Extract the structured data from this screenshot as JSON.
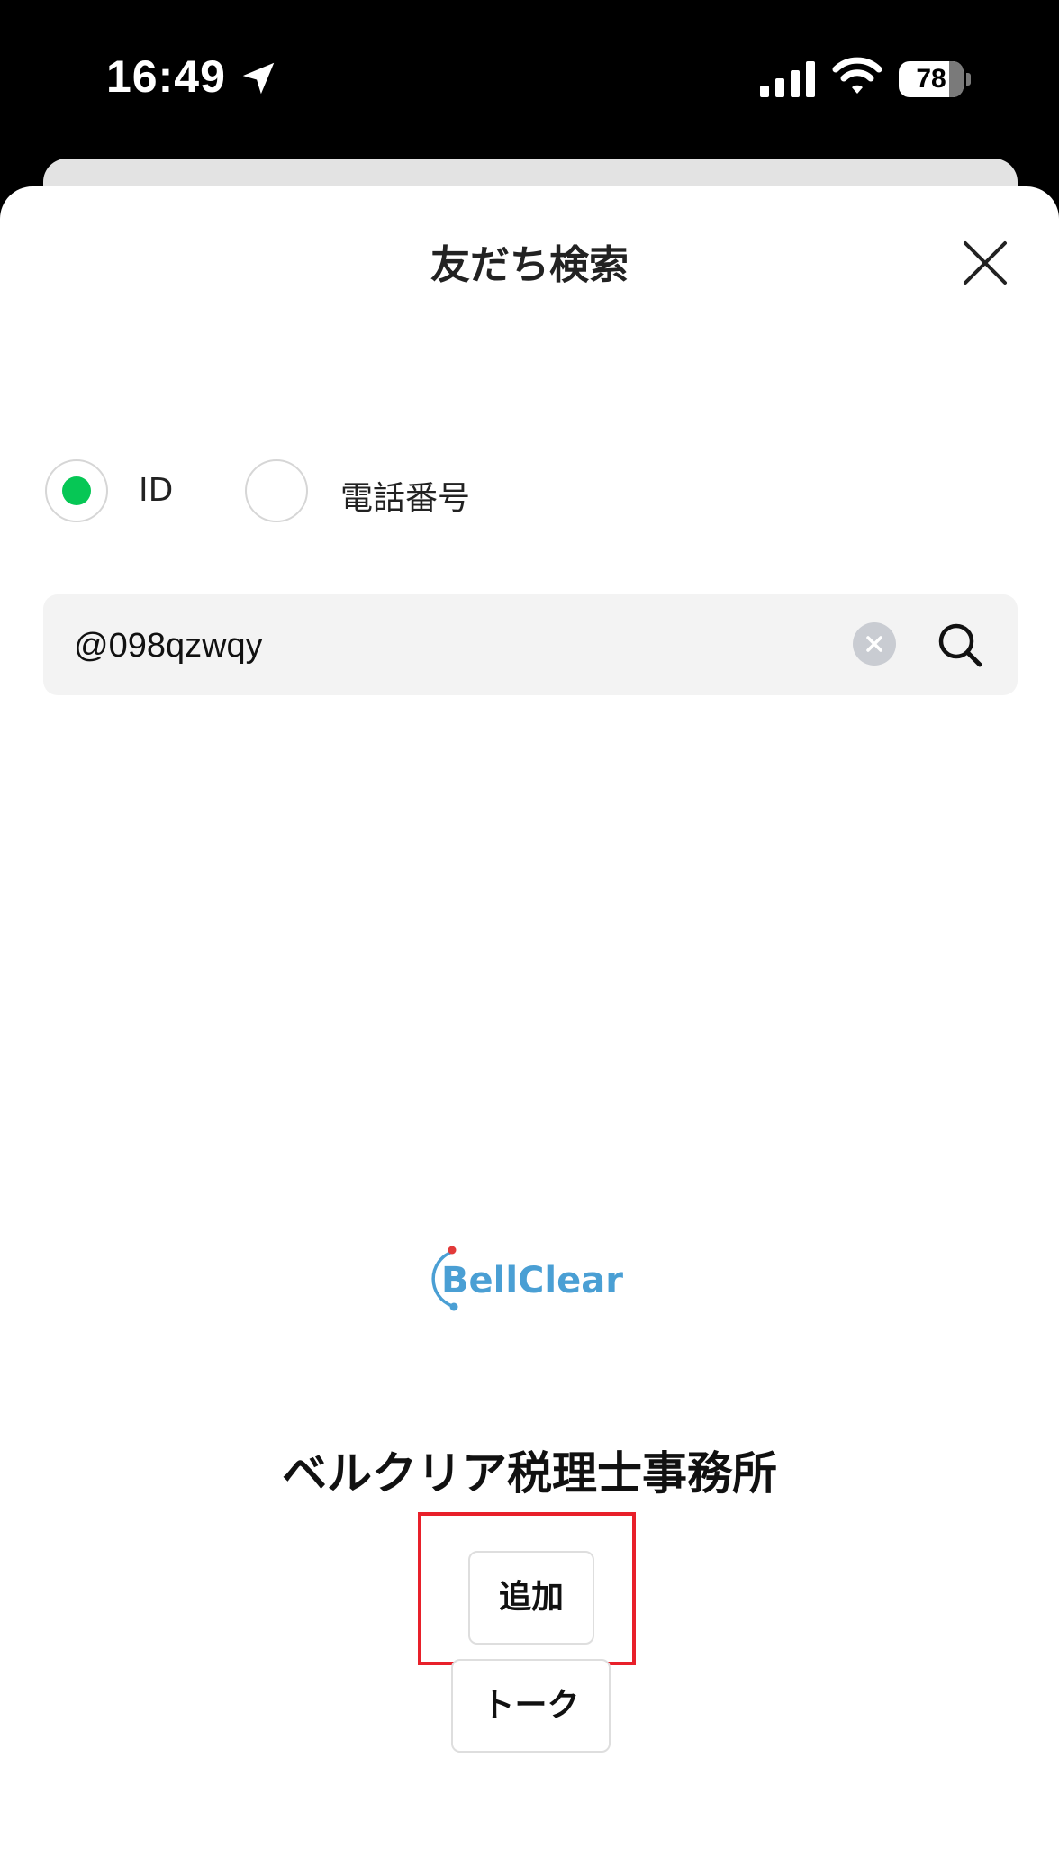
{
  "status_bar": {
    "time": "16:49",
    "battery_level": "78",
    "battery_fraction": 0.78,
    "icons": [
      "location-arrow-icon",
      "cellular-signal-icon",
      "wifi-icon",
      "battery-icon"
    ]
  },
  "sheet": {
    "title": "友だち検索",
    "close_icon": "close-icon"
  },
  "search_type": {
    "options": [
      {
        "label": "ID",
        "selected": true
      },
      {
        "label": "電話番号",
        "selected": false
      }
    ],
    "selected_color": "#06c755"
  },
  "search": {
    "value": "@098qzwqy",
    "clear_icon": "clear-icon",
    "search_icon": "search-icon"
  },
  "result": {
    "logo_text": "BellClear",
    "logo_color": "#4a9fd4",
    "account_name": "ベルクリア税理士事務所",
    "add_label": "追加",
    "talk_label": "トーク"
  },
  "highlight_color": "#e8202a"
}
